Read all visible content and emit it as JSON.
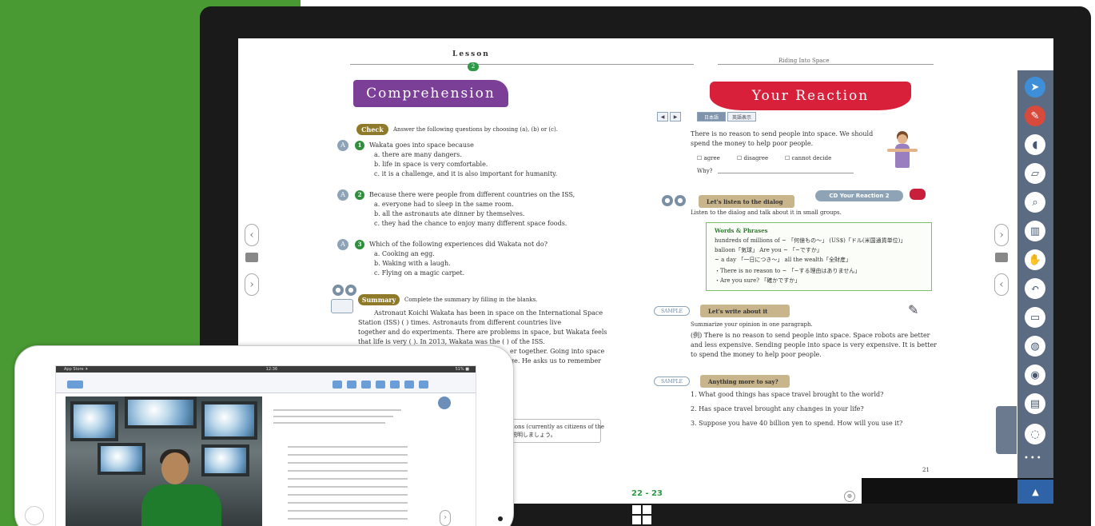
{
  "book": {
    "lesson_label": "Lesson",
    "lesson_num": "2",
    "running_head": "Riding Into Space",
    "left": {
      "banner": "Comprehension",
      "check_tag": "Check",
      "check_instruction": "Answer the following questions by choosing (a), (b) or (c).",
      "q1": {
        "num": "1",
        "stem": "Wakata goes into space because",
        "a": "a. there are many dangers.",
        "b": "b. life in space is very comfortable.",
        "c": "c. it is a challenge, and it is also important for humanity."
      },
      "q2": {
        "num": "2",
        "stem": "Because there were people from different countries on the ISS,",
        "a": "a. everyone had to sleep in the same room.",
        "b": "b. all the astronauts ate dinner by themselves.",
        "c": "c. they had the chance to enjoy many different space foods."
      },
      "q3": {
        "num": "3",
        "stem": "Which of the following experiences did Wakata not do?",
        "a": "a. Cooking an egg.",
        "b": "b. Waking with a laugh.",
        "c": "c. Flying on a magic carpet."
      },
      "summary_tag": "Summary",
      "summary_instruction": "Complete the summary by filling in the blanks.",
      "summary_l1": "Astronaut Koichi Wakata has been in space on the International Space",
      "summary_l2": "Station (ISS) (          ) times.  Astronauts from different countries live",
      "summary_l3": "together and do experiments.  There are problems in space, but Wakata feels",
      "summary_l4": "that life is very (          ).  In 2013, Wakata was the (          ) of the ISS.",
      "summary_l5": "er together.  Going into space",
      "summary_l6": "ge.  He asks us to remember",
      "jp_note_1": "sitions (currently as citizens of the",
      "jp_note_2": "で説明しましょう。"
    },
    "right": {
      "banner": "Your Reaction",
      "opinion": "There is no reason to send people into space.  We should spend the money to help poor people.",
      "opt_agree": "agree",
      "opt_disagree": "disagree",
      "opt_cannot": "cannot decide",
      "why": "Why?",
      "listen_tag": "Let's listen to the dialog",
      "listen_link": "CD Your Reaction 2",
      "listen_instruction": "Listen to the dialog and talk about it in small groups.",
      "words_title": "Words & Phrases",
      "words_l1": "hundreds of millions of ~  「何億もの～」       (US$)「ドル(米国通貨単位)」",
      "words_l2": "balloon「気球」          Are you ~ 「~ですか」",
      "words_l3": "~ a day 「一日につき～」     all the wealth「全財産」",
      "words_l4": "・There is no reason to ~ 「~する理由はありません」",
      "words_l5": "・Are you sure? 「確かですか」",
      "write_tag": "Let's write about it",
      "write_instruction": "Summarize your opinion in one paragraph.",
      "write_p1": "(例) There is no reason to send people into space.  Space robots are better",
      "write_p2": "and less expensive.  Sending people into space is very expensive.  It is better",
      "write_p3": "to spend the money to help poor people.",
      "more_tag": "Anything more to say?",
      "more_q1": "1. What good things has space travel brought to the world?",
      "more_q2": "2. Has space travel brought any changes in your life?",
      "more_q3": "3. Suppose you have 40 billion yen to spend.  How will you use it?",
      "sample": "SAMPLE",
      "page_foot": "21"
    },
    "page_indicator": "22 - 23",
    "sample": "SAMPLE",
    "btn_labels": [
      "◀",
      "▶",
      "日本語",
      "英語表示"
    ]
  },
  "toolbar": {
    "icons": [
      "cursor-icon",
      "pen-icon",
      "marker-icon",
      "eraser-icon",
      "zoom-page-icon",
      "book-icon",
      "hand-icon",
      "undo-icon",
      "screen-icon",
      "globe-icon",
      "camera-icon",
      "note-icon",
      "chat-icon"
    ],
    "more": "•••",
    "up": "▲"
  },
  "tablet": {
    "status_left": "App Store ✈",
    "status_time": "12:36",
    "status_right": "51% ■"
  },
  "side_nav": {
    "prev": "‹",
    "next": "›",
    "prev_r": "›",
    "next_r": "‹"
  }
}
